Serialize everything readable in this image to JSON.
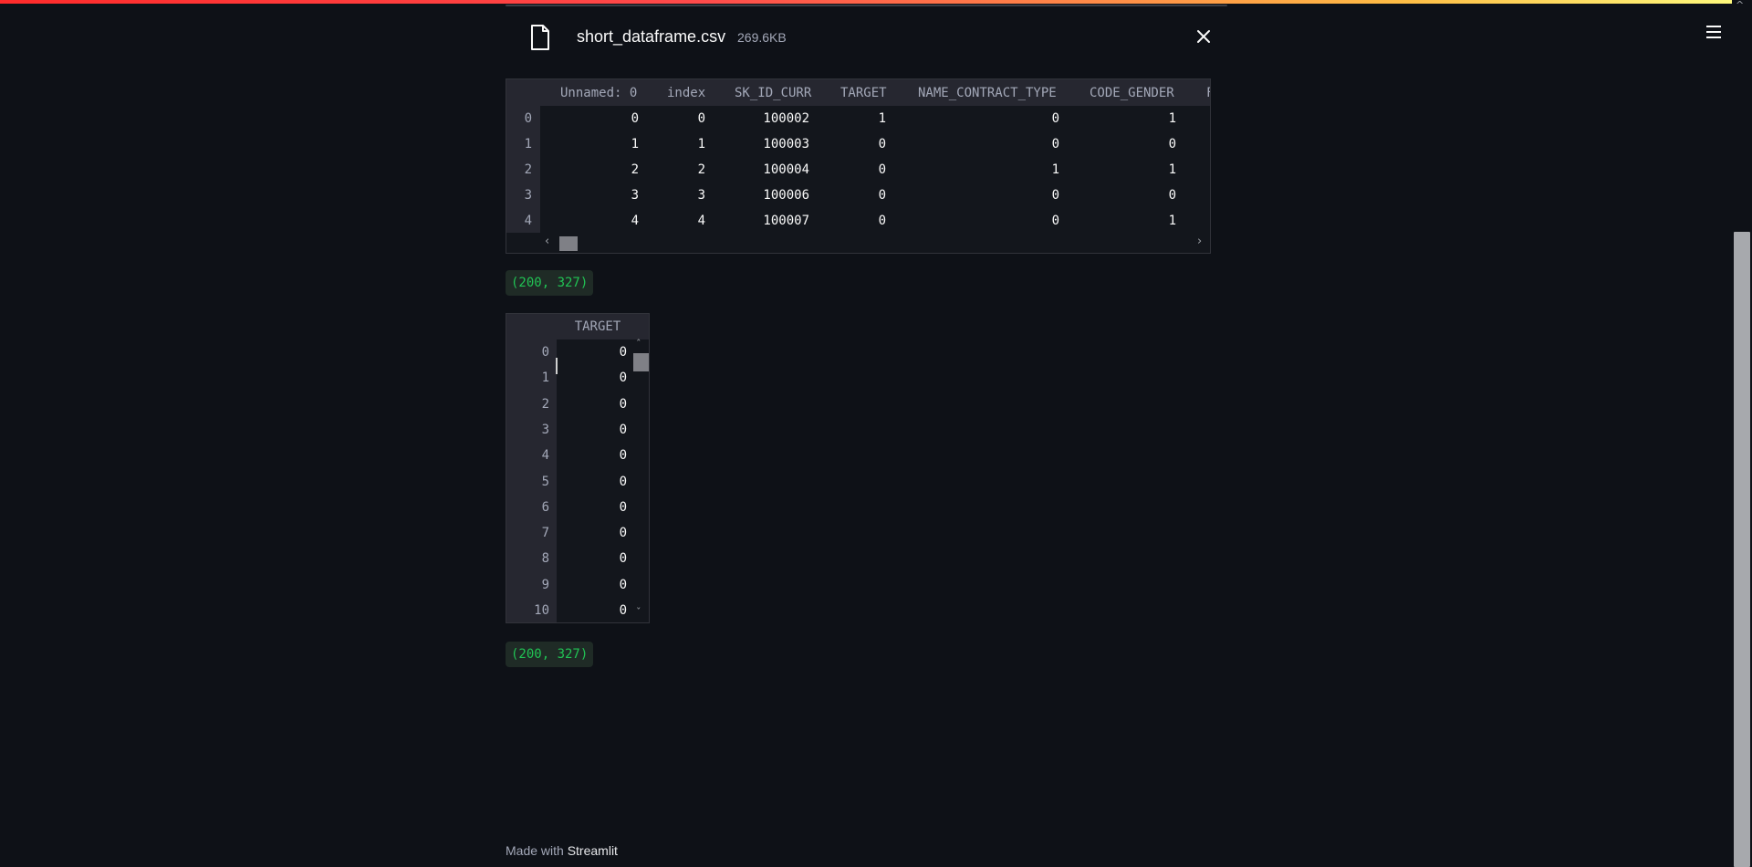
{
  "file": {
    "name": "short_dataframe.csv",
    "size": "269.6KB",
    "close_icon": "close-icon",
    "file_icon": "file-icon"
  },
  "dataframe1": {
    "columns": [
      "Unnamed: 0",
      "index",
      "SK_ID_CURR",
      "TARGET",
      "NAME_CONTRACT_TYPE",
      "CODE_GENDER",
      "F"
    ],
    "index": [
      "0",
      "1",
      "2",
      "3",
      "4"
    ],
    "rows": [
      [
        "0",
        "0",
        "100002",
        "1",
        "0",
        "1"
      ],
      [
        "1",
        "1",
        "100003",
        "0",
        "0",
        "0"
      ],
      [
        "2",
        "2",
        "100004",
        "0",
        "1",
        "1"
      ],
      [
        "3",
        "3",
        "100006",
        "0",
        "0",
        "0"
      ],
      [
        "4",
        "4",
        "100007",
        "0",
        "0",
        "1"
      ]
    ]
  },
  "shape1": "(200, 327)",
  "dataframe2": {
    "column": "TARGET",
    "index": [
      "0",
      "1",
      "2",
      "3",
      "4",
      "5",
      "6",
      "7",
      "8",
      "9",
      "10"
    ],
    "values": [
      "0",
      "0",
      "0",
      "0",
      "0",
      "0",
      "0",
      "0",
      "0",
      "0",
      "0"
    ]
  },
  "shape2": "(200, 327)",
  "footer": {
    "prefix": "Made with",
    "brand": "Streamlit"
  }
}
